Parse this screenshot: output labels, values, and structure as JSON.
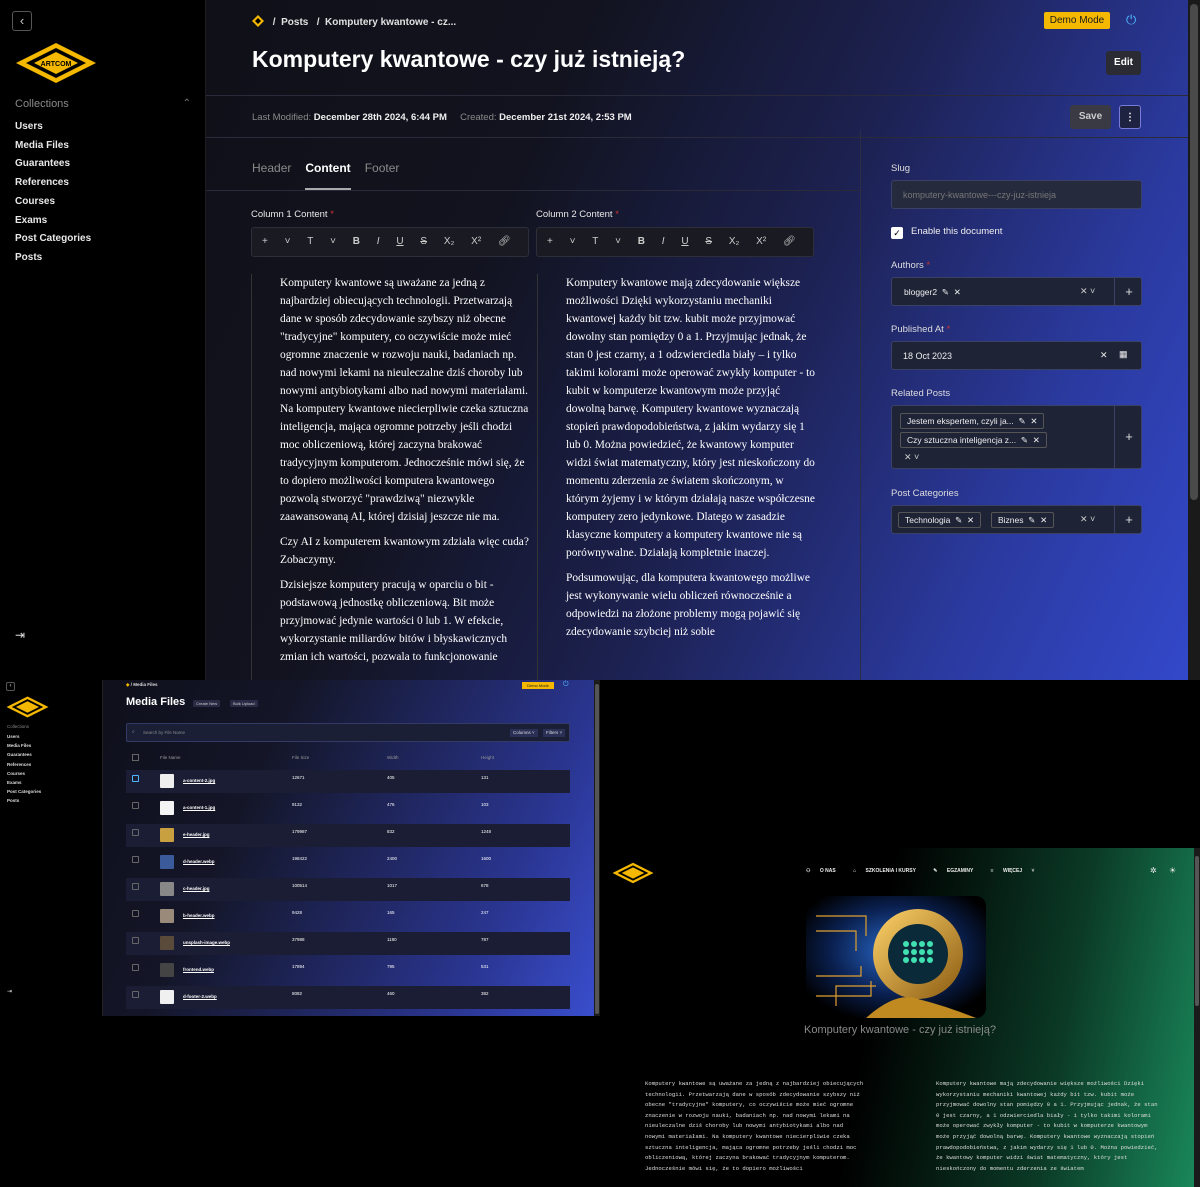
{
  "cms": {
    "sidebar": {
      "collections_label": "Collections",
      "items": [
        "Users",
        "Media Files",
        "Guarantees",
        "References",
        "Courses",
        "Exams",
        "Post Categories",
        "Posts"
      ]
    },
    "logo_text": "ARTCOM",
    "breadcrumb": {
      "sep": "/",
      "parent": "Posts",
      "current": "Komputery kwantowe - cz..."
    },
    "demo_mode": "Demo Mode",
    "title": "Komputery kwantowe - czy już istnieją?",
    "edit_label": "Edit",
    "meta": {
      "last_modified_label": "Last Modified:",
      "last_modified": "December 28th 2024, 6:44 PM",
      "created_label": "Created:",
      "created": "December 21st 2024, 2:53 PM"
    },
    "save_label": "Save",
    "tabs": [
      "Header",
      "Content",
      "Footer"
    ],
    "active_tab": "Content",
    "column1_label": "Column 1 Content",
    "column2_label": "Column 2 Content",
    "required_mark": "*",
    "toolbar": [
      "+",
      "T",
      "B",
      "I",
      "U",
      "S",
      "X₂",
      "X²"
    ],
    "column1_paragraphs": [
      "Komputery kwantowe są uważane za jedną z najbardziej obiecujących technologii. Przetwarzają dane w sposób zdecydowanie szybszy niż obecne \"tradycyjne\" komputery, co oczywiście może mieć ogromne znaczenie w rozwoju nauki, badaniach np. nad nowymi lekami na nieuleczalne dziś choroby lub nowymi antybiotykami albo nad nowymi materiałami. Na komputery kwantowe niecierpliwie czeka sztuczna inteligencja, mająca ogromne potrzeby jeśli chodzi moc obliczeniową, której zaczyna brakować tradycyjnym komputerom. Jednocześnie mówi się, że to dopiero możliwości komputera kwantowego pozwolą stworzyć \"prawdziwą\" niezwykle zaawansowaną AI, której dzisiaj jeszcze nie ma.",
      "Czy AI z komputerem kwantowym zdziała więc cuda? Zobaczymy.",
      "Dzisiejsze komputery pracują w oparciu o bit - podstawową jednostkę obliczeniową. Bit może przyjmować jedynie wartości 0 lub 1. W efekcie, wykorzystanie miliardów bitów i błyskawicznych zmian ich wartości, pozwala to funkcjonowanie"
    ],
    "column2_paragraphs": [
      "Komputery kwantowe mają zdecydowanie większe możliwości Dzięki wykorzystaniu mechaniki kwantowej każdy bit tzw. kubit może przyjmować dowolny stan pomiędzy 0 a 1. Przyjmując jednak, że stan 0 jest czarny, a 1 odzwierciedla biały – i tylko takimi kolorami może operować zwykły komputer - to kubit w komputerze kwantowym może przyjąć dowolną barwę. Komputery kwantowe wyznaczają stopień prawdopodobieństwa, z jakim wydarzy się 1 lub 0. Można powiedzieć, że kwantowy komputer widzi świat matematyczny, który jest nieskończony do momentu zderzenia ze światem skończonym, w którym żyjemy i w którym działają nasze współczesne komputery zero jedynkowe. Dlatego w zasadzie klasyczne komputery a komputery kwantowe nie są porównywalne. Działają kompletnie inaczej.",
      "Podsumowując, dla komputera kwantowego możliwe jest wykonywanie wielu obliczeń równocześnie a odpowiedzi na złożone problemy mogą pojawić się zdecydowanie szybciej niż sobie"
    ],
    "slug_label": "Slug",
    "slug_value": "komputery-kwantowe---czy-juz-istnieja",
    "enable_label": "Enable this document",
    "authors_label": "Authors",
    "author": "blogger2",
    "published_label": "Published At",
    "published_value": "18 Oct 2023",
    "related_label": "Related Posts",
    "related": [
      "Jestem ekspertem, czyli ja...",
      "Czy sztuczna inteligencja z..."
    ],
    "categories_label": "Post Categories",
    "categories": [
      "Technologia",
      "Biznes"
    ]
  },
  "media": {
    "breadcrumb": "Media Files",
    "demo_mode": "Demo Mode",
    "title": "Media Files",
    "create_new": "Create New",
    "bulk_upload": "Bulk Upload",
    "search_placeholder": "Search by File Name",
    "columns_btn": "Columns",
    "filters_btn": "Filters",
    "headers": [
      "File Name",
      "File Size",
      "Width",
      "Height"
    ],
    "rows": [
      {
        "name": "a-content-2.jpg",
        "size": "12671",
        "w": "405",
        "h": "131"
      },
      {
        "name": "a-content-1.jpg",
        "size": "9132",
        "w": "476",
        "h": "103"
      },
      {
        "name": "e-header.jpg",
        "size": "179987",
        "w": "832",
        "h": "1248"
      },
      {
        "name": "d-header.webp",
        "size": "198422",
        "w": "2400",
        "h": "1600"
      },
      {
        "name": "c-header.jpg",
        "size": "100514",
        "w": "1017",
        "h": "678"
      },
      {
        "name": "b-header.webp",
        "size": "9428",
        "w": "165",
        "h": "247"
      },
      {
        "name": "unsplash-image.webp",
        "size": "37988",
        "w": "1180",
        "h": "787"
      },
      {
        "name": "frontend.webp",
        "size": "17894",
        "w": "795",
        "h": "531"
      },
      {
        "name": "d-footer-2.webp",
        "size": "8082",
        "w": "460",
        "h": "382"
      }
    ]
  },
  "site": {
    "nav": [
      "O NAS",
      "SZKOLENIA I KURSY",
      "EGZAMINY",
      "WIĘCEJ"
    ],
    "title": "Komputery kwantowe - czy już istnieją?",
    "col1": "Komputery kwantowe są uważane za jedną z najbardziej obiecujących technologii. Przetwarzają dane w sposób zdecydowanie szybszy niż obecne \"tradycyjne\" komputery, co oczywiście może mieć ogromne znaczenie w rozwoju nauki, badaniach np. nad nowymi lekami na nieuleczalne dziś choroby lub nowymi antybiotykami albo nad nowymi materiałami. Na komputery kwantowe niecierpliwie czeka sztuczna inteligencja, mająca ogromne potrzeby jeśli chodzi moc obliczeniową, której zaczyna brakować tradycyjnym komputerom. Jednocześnie mówi się, że to dopiero możliwości",
    "col2": "Komputery kwantowe mają zdecydowanie większe możliwości Dzięki wykorzystaniu mechaniki kwantowej każdy bit tzw. kubit może przyjmować dowolny stan pomiędzy 0 a 1. Przyjmując jednak, że stan 0 jest czarny, a 1 odzwierciedla biały - i tylko takimi kolorami może operować zwykły komputer - to kubit w komputerze kwantowym może przyjąć dowolną barwę. Komputery kwantowe wyznaczają stopień prawdopodobieństwa, z jakim wydarzy się 1 lub 0. Można powiedzieć, że kwantowy komputer widzi świat matematyczny, który jest nieskończony do momentu zderzenia ze światem"
  },
  "colors": {
    "accent": "#f5b800",
    "link": "#4fb8ff",
    "required": "#cc3333"
  }
}
